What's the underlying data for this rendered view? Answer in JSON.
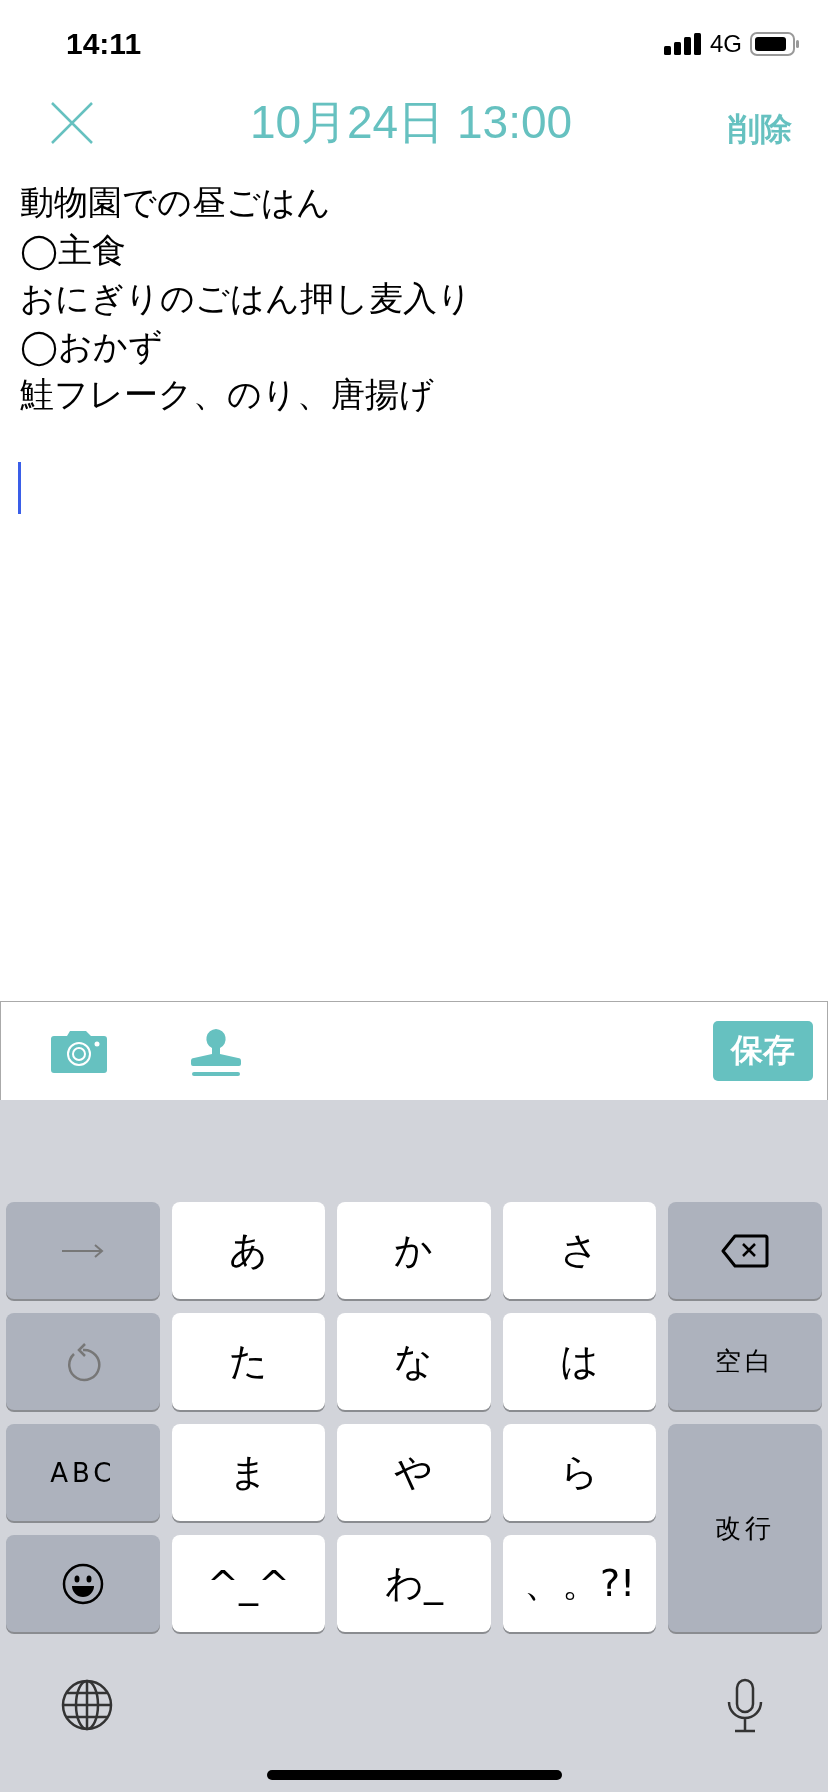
{
  "status_bar": {
    "time": "14:11",
    "network": "4G"
  },
  "header": {
    "title": "10月24日 13:00",
    "delete": "削除"
  },
  "note": {
    "lines": [
      "動物園での昼ごはん",
      "◯主食",
      "おにぎりのごはん押し麦入り",
      "◯おかず",
      "鮭フレーク、のり、唐揚げ"
    ]
  },
  "toolbar": {
    "save": "保存"
  },
  "keyboard": {
    "keys": [
      {
        "kind": "arrow"
      },
      {
        "kind": "letter",
        "label": "あ"
      },
      {
        "kind": "letter",
        "label": "か"
      },
      {
        "kind": "letter",
        "label": "さ"
      },
      {
        "kind": "delete"
      },
      {
        "kind": "undo"
      },
      {
        "kind": "letter",
        "label": "た"
      },
      {
        "kind": "letter",
        "label": "な"
      },
      {
        "kind": "letter",
        "label": "は"
      },
      {
        "kind": "function",
        "label": "空白"
      },
      {
        "kind": "function",
        "label": "ABC"
      },
      {
        "kind": "letter",
        "label": "ま"
      },
      {
        "kind": "letter",
        "label": "や"
      },
      {
        "kind": "letter",
        "label": "ら"
      },
      {
        "kind": "return",
        "label": "改行"
      },
      {
        "kind": "emoji"
      },
      {
        "kind": "letter",
        "label": "^_^"
      },
      {
        "kind": "letter",
        "label": "わ_"
      },
      {
        "kind": "letter",
        "label": "、。?!"
      }
    ]
  }
}
